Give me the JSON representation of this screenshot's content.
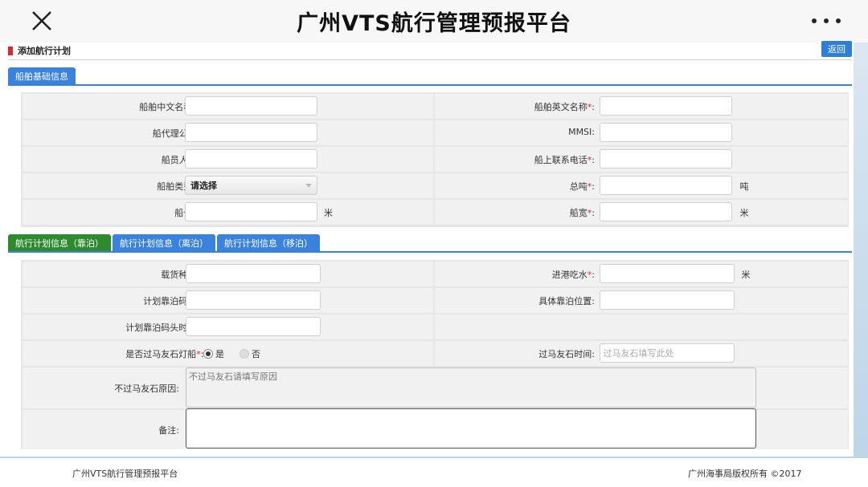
{
  "app": {
    "title": "广州VTS航行管理预报平台"
  },
  "page": {
    "title": "添加航行计划",
    "back_label": "返回"
  },
  "tabs_basic": [
    {
      "label": "船舶基础信息"
    }
  ],
  "basic": {
    "cn_name_label": "船舶中文名称",
    "en_name_label": "船舶英文名称",
    "agent_label": "船代理公司:",
    "mmsi_label": "MMSI:",
    "crew_label": "船员人数:",
    "phone_label": "船上联系电话",
    "type_label": "船舶类型",
    "type_value": "请选择",
    "tonnage_label": "总吨",
    "tonnage_unit": "吨",
    "length_label": "船长",
    "length_unit": "米",
    "width_label": "船宽",
    "width_unit": "米"
  },
  "tabs_plan": [
    {
      "label": "航行计划信息（靠泊）"
    },
    {
      "label": "航行计划信息（离泊）"
    },
    {
      "label": "航行计划信息（移泊）"
    }
  ],
  "plan": {
    "cargo_label": "载货种类",
    "draft_label": "进港吃水",
    "draft_unit": "米",
    "berth_label": "计划靠泊码头",
    "position_label": "具体靠泊位置:",
    "berth_time_label": "计划靠泊码头时间",
    "pass_label": "是否过马友石灯船",
    "yes_label": "是",
    "no_label": "否",
    "pass_time_label": "过马友石时间:",
    "pass_time_placeholder": "过马友石填写此处",
    "reason_label": "不过马友石原因:",
    "reason_placeholder": "不过马友石请填写原因",
    "remark_label": "备注:"
  },
  "footer": {
    "left": "广州VTS航行管理预报平台",
    "right": "广州海事局版权所有 ©2017"
  },
  "colors": {
    "accent": "#3b82dc",
    "green_tab": "#2e8a2e",
    "required": "#d52b2b"
  }
}
